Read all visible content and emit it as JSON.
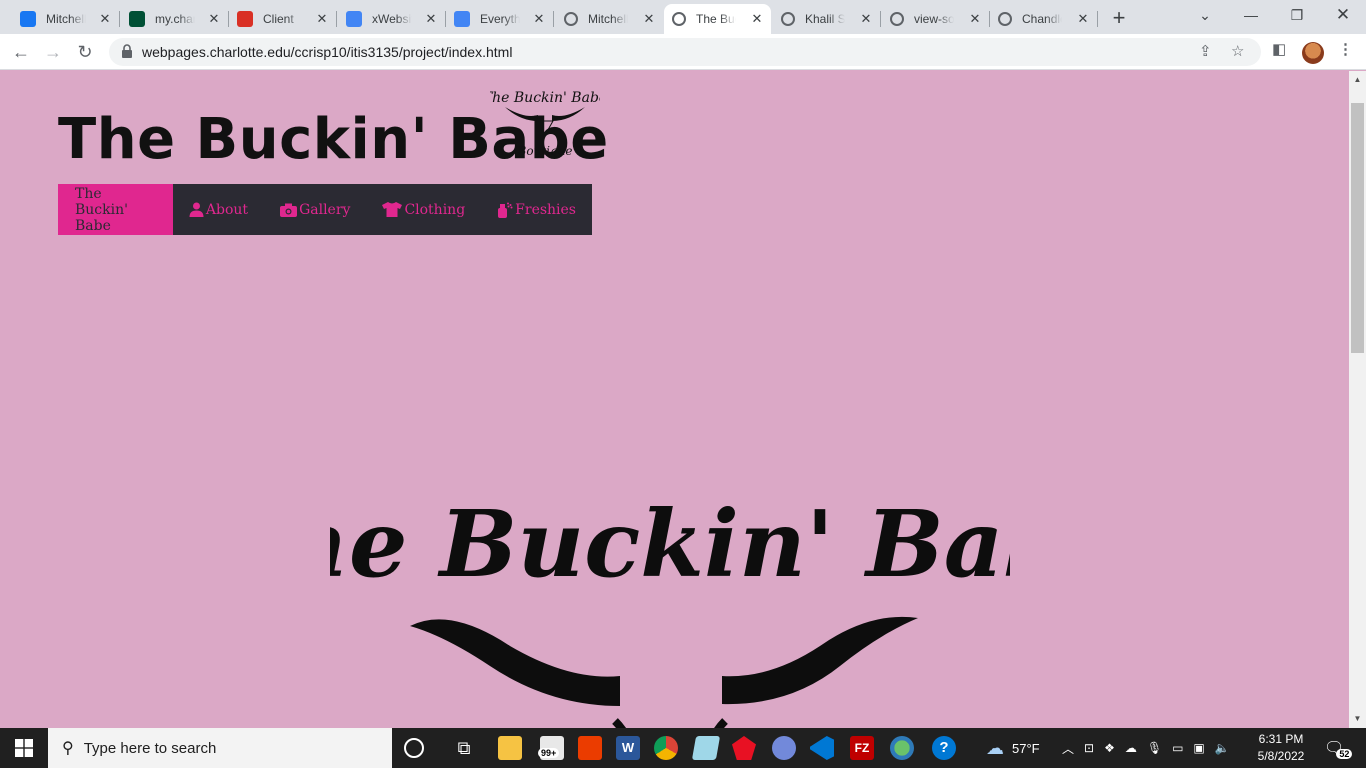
{
  "browser": {
    "tabs": [
      {
        "title": "Mitchell",
        "icon": "facebook-icon",
        "color": "#1877f2"
      },
      {
        "title": "my.charlotte",
        "icon": "unc-charlotte-icon",
        "color": "#005035"
      },
      {
        "title": "Client",
        "icon": "tools-icon",
        "color": "#d93025"
      },
      {
        "title": "xWebsite",
        "icon": "google-docs-icon",
        "color": "#4285f4"
      },
      {
        "title": "Everything",
        "icon": "google-docs-icon",
        "color": "#4285f4"
      },
      {
        "title": "Mitchell",
        "icon": "globe-icon",
        "color": "#5f6368"
      },
      {
        "title": "The Buckin' Babe",
        "icon": "globe-icon",
        "color": "#5f6368"
      },
      {
        "title": "Khalil Sh",
        "icon": "globe-icon",
        "color": "#5f6368"
      },
      {
        "title": "view-source",
        "icon": "globe-icon",
        "color": "#5f6368"
      },
      {
        "title": "Chandler",
        "icon": "globe-icon",
        "color": "#5f6368"
      }
    ],
    "active_tab_index": 6,
    "url": "webpages.charlotte.edu/ccrisp10/itis3135/project/index.html"
  },
  "site": {
    "title": "The Buckin' Babe",
    "logo_text_top": "The Buckin' Babe",
    "logo_text_bottom": "Boutique",
    "nav": [
      {
        "label": "The Buckin' Babe",
        "icon": null,
        "active": true
      },
      {
        "label": "About",
        "icon": "user-icon",
        "active": false
      },
      {
        "label": "Gallery",
        "icon": "camera-icon",
        "active": false
      },
      {
        "label": "Clothing",
        "icon": "shirt-icon",
        "active": false
      },
      {
        "label": "Freshies",
        "icon": "spray-bottle-icon",
        "active": false
      }
    ],
    "hero_text": "The Buckin' Babe",
    "colors": {
      "background": "#dba8c6",
      "nav_bg": "#2b2a33",
      "accent": "#e0278f"
    }
  },
  "taskbar": {
    "search_placeholder": "Type here to search",
    "weather": "57°F",
    "time": "6:31 PM",
    "date": "5/8/2022",
    "notification_count": "52",
    "mail_badge": "99+"
  }
}
